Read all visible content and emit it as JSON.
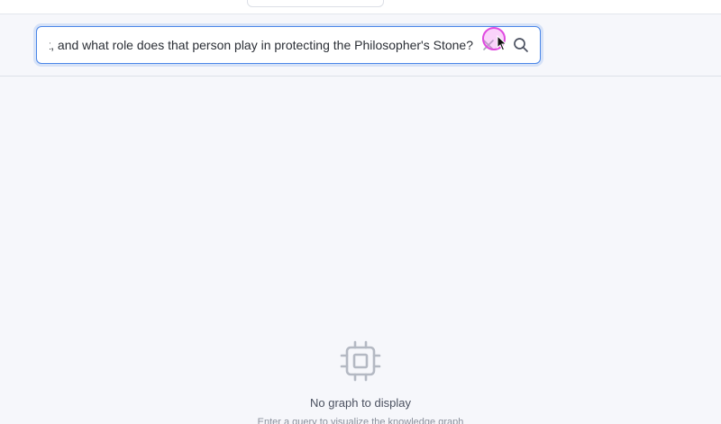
{
  "search": {
    "query": "Who is the person that Harry Potter meets at Hogwarts who knows about Nicolas Flamel's achievement, and what role does that person play in protecting the Philosopher's Stone?",
    "visible_query": "nt, and what role does that person play in protecting the Philosopher's Stone?",
    "clear_icon": "close-icon",
    "search_icon": "search-icon",
    "accent_color": "#4a86e8"
  },
  "empty_state": {
    "icon": "chip-icon",
    "title": "No graph to display",
    "subtitle": "Enter a query to visualize the knowledge graph"
  }
}
